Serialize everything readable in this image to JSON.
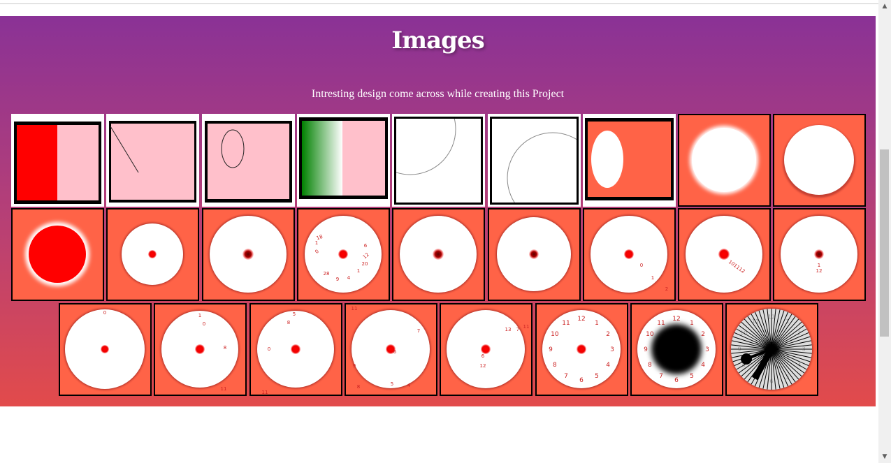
{
  "section": {
    "title": "Images",
    "subtitle": "Intresting design come across while creating this Project"
  },
  "colors": {
    "gradient_top": "#8a3296",
    "gradient_bottom": "#e24b4b",
    "tile_orange": "#ff6347",
    "pink": "#ffc0cb",
    "red": "#ff0000",
    "green": "#008000"
  },
  "clock_numbers": [
    "12",
    "1",
    "2",
    "3",
    "4",
    "5",
    "6",
    "7",
    "8",
    "9",
    "10",
    "11"
  ],
  "images": [
    {
      "id": 1,
      "kind": "red-pink-rect"
    },
    {
      "id": 2,
      "kind": "pink-line"
    },
    {
      "id": 3,
      "kind": "pink-ellipse"
    },
    {
      "id": 4,
      "kind": "green-gradient-rect"
    },
    {
      "id": 5,
      "kind": "arc-top-left"
    },
    {
      "id": 6,
      "kind": "arc-bottom-right"
    },
    {
      "id": 7,
      "kind": "white-ellipse"
    },
    {
      "id": 8,
      "kind": "blurred-white-circle"
    },
    {
      "id": 9,
      "kind": "white-circle"
    },
    {
      "id": 10,
      "kind": "red-circle-glow"
    },
    {
      "id": 11,
      "kind": "small-clock-face"
    },
    {
      "id": 12,
      "kind": "clock-face-dark-dot"
    },
    {
      "id": 13,
      "kind": "scattered-numbers"
    },
    {
      "id": 14,
      "kind": "clock-face-dark-dot"
    },
    {
      "id": 15,
      "kind": "numbers-bottom-right"
    },
    {
      "id": 16,
      "kind": "numbers-diagonal"
    },
    {
      "id": 17,
      "kind": "numbers-down"
    },
    {
      "id": 18,
      "kind": "number-top"
    },
    {
      "id": 19,
      "kind": "numbers-spread-a"
    },
    {
      "id": 20,
      "kind": "numbers-spread-b"
    },
    {
      "id": 21,
      "kind": "numbers-spread-c"
    },
    {
      "id": 22,
      "kind": "numbers-spread-d"
    },
    {
      "id": 23,
      "kind": "full-clock"
    },
    {
      "id": 24,
      "kind": "clock-black-center"
    },
    {
      "id": 25,
      "kind": "clock-partial-lines"
    },
    {
      "id": 26,
      "kind": "clock-full-lines"
    }
  ]
}
